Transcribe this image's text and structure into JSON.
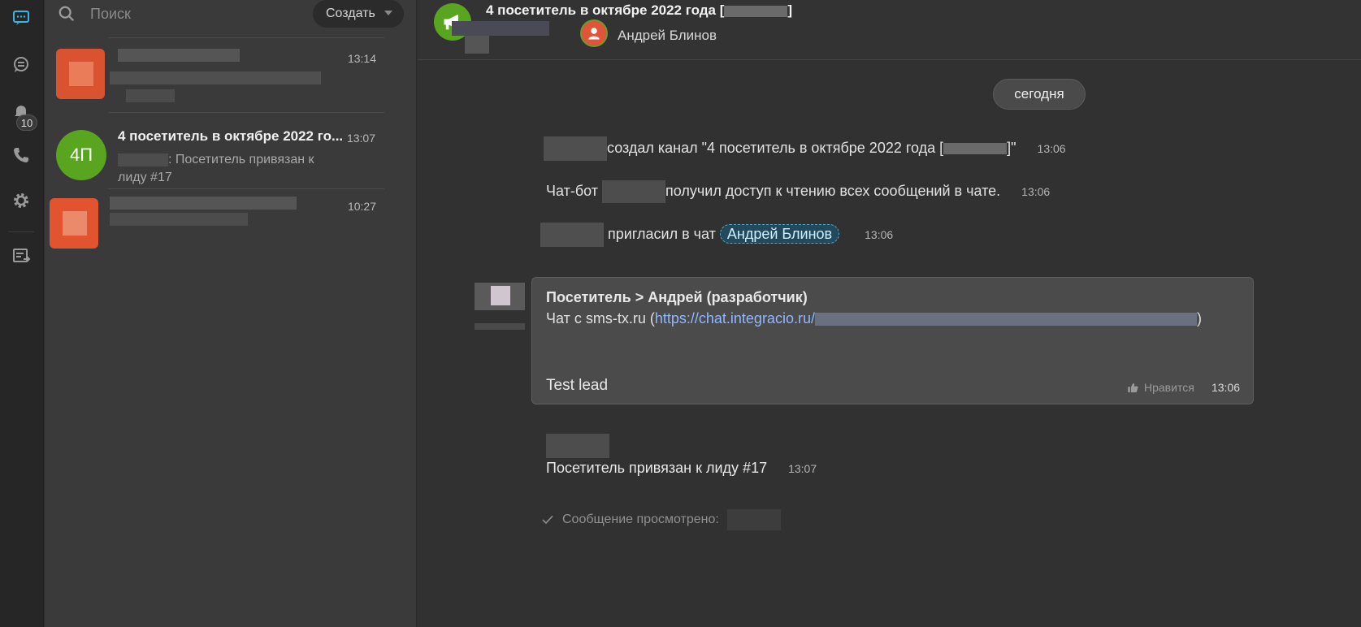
{
  "colors": {
    "accent_green": "#5aa51f",
    "link": "#8fb8ff",
    "mention_bg": "#234a5c"
  },
  "rail": {
    "items": [
      {
        "name": "chats-icon",
        "active": true
      },
      {
        "name": "channels-icon"
      },
      {
        "name": "notifications-icon",
        "badge": "10"
      },
      {
        "name": "phone-icon"
      },
      {
        "name": "settings-icon"
      },
      {
        "name": "tasks-icon"
      }
    ]
  },
  "sidebar": {
    "search_placeholder": "Поиск",
    "create_label": "Создать",
    "chats": [
      {
        "time": "13:14"
      },
      {
        "avatar_text": "4П",
        "title": "4 посетитель в октябре 2022 го...",
        "time": "13:07",
        "preview": ": Посетитель привязан к лиду #17"
      },
      {
        "time": "10:27"
      }
    ]
  },
  "header": {
    "title": "4 посетитель в октябре 2022 года [",
    "title_end": "]",
    "member_name": "Андрей Блинов"
  },
  "messages": {
    "date_pill": "сегодня",
    "created": {
      "text": "создал канал \"4 посетитель в октябре 2022 года [",
      "text_end": "]\"",
      "time": "13:06"
    },
    "bot_access": {
      "prefix": "Чат-бот",
      "text": "получил доступ к чтению всех сообщений в чате.",
      "time": "13:06"
    },
    "invited": {
      "text": "пригласил в чат",
      "mention": "Андрей Блинов",
      "time": "13:06"
    },
    "bubble": {
      "author": "Посетитель > Андрей (разработчик)",
      "line_prefix": "Чат с sms-tx.ru (",
      "link": "https://chat.integracio.ru/",
      "line_suffix": ")",
      "text": "Test lead",
      "like_label": "Нравится",
      "time": "13:06"
    },
    "linked": {
      "text": "Посетитель привязан к лиду #17",
      "time": "13:07"
    },
    "seen_label": "Сообщение просмотрено:"
  }
}
